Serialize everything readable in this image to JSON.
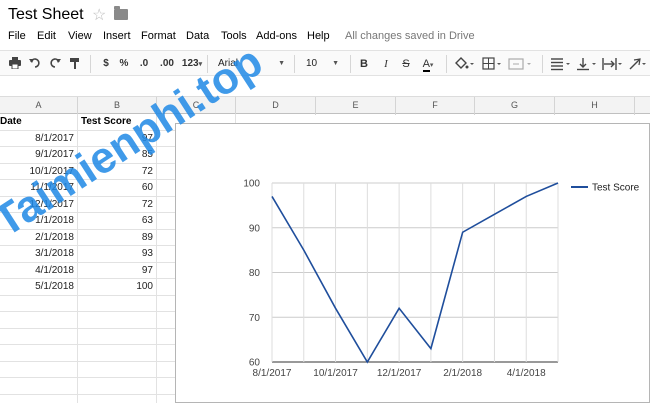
{
  "title_bar": {
    "doc_title": "Test Sheet",
    "star_icon": "star-icon",
    "folder_icon": "folder-icon"
  },
  "menu": {
    "items": [
      "File",
      "Edit",
      "View",
      "Insert",
      "Format",
      "Data",
      "Tools",
      "Add-ons",
      "Help"
    ],
    "save_status": "All changes saved in Drive"
  },
  "toolbar": {
    "currency": "$",
    "percent": "%",
    "dec_decrease": ".0",
    "dec_increase": ".00",
    "more_formats": "123",
    "font": "Arial",
    "font_size": "10",
    "bold": "B",
    "italic": "I",
    "strike": "S",
    "text_color": "A"
  },
  "columns": [
    "A",
    "B",
    "C",
    "D",
    "E",
    "F",
    "G",
    "H"
  ],
  "sheet": {
    "headers": [
      "Date",
      "Test Score"
    ],
    "rows": [
      [
        "8/1/2017",
        "97"
      ],
      [
        "9/1/2017",
        "85"
      ],
      [
        "10/1/2017",
        "72"
      ],
      [
        "11/1/2017",
        "60"
      ],
      [
        "12/1/2017",
        "72"
      ],
      [
        "1/1/2018",
        "63"
      ],
      [
        "2/1/2018",
        "89"
      ],
      [
        "3/1/2018",
        "93"
      ],
      [
        "4/1/2018",
        "97"
      ],
      [
        "5/1/2018",
        "100"
      ]
    ]
  },
  "chart_data": {
    "type": "line",
    "x": [
      "8/1/2017",
      "9/1/2017",
      "10/1/2017",
      "11/1/2017",
      "12/1/2017",
      "1/1/2018",
      "2/1/2018",
      "3/1/2018",
      "4/1/2018",
      "5/1/2018"
    ],
    "series": [
      {
        "name": "Test Score",
        "values": [
          97,
          85,
          72,
          60,
          72,
          63,
          89,
          93,
          97,
          100
        ],
        "color": "#1f4e9c"
      }
    ],
    "x_tick_labels": [
      "8/1/2017",
      "10/1/2017",
      "12/1/2017",
      "2/1/2018",
      "4/1/2018"
    ],
    "y_ticks": [
      60,
      70,
      80,
      90,
      100
    ],
    "ylim": [
      60,
      100
    ],
    "legend_position": "right",
    "grid": true
  },
  "watermark": {
    "text": "Taimienphi.top",
    "color": "#1e88e5"
  }
}
